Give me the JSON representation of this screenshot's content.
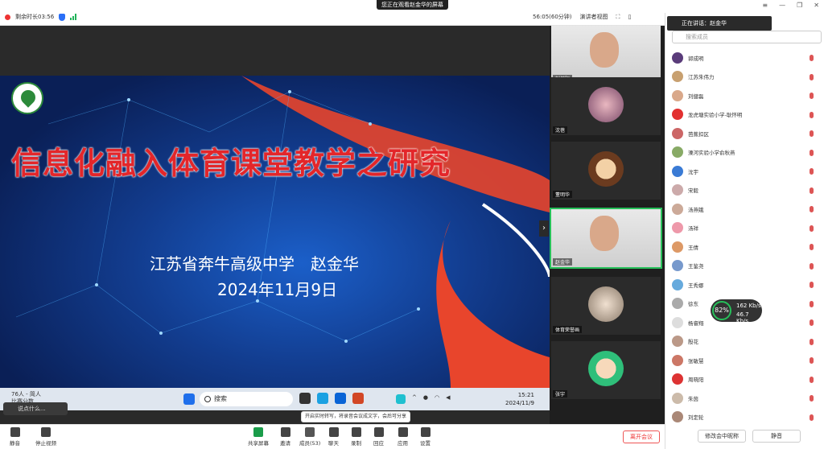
{
  "banner": "您正在观看赵金华的屏幕",
  "topbar": {
    "remaining": "剩余时长03:56",
    "duration": "56:05(60分钟)",
    "view_mode": "演讲者视图"
  },
  "slide": {
    "title": "信息化融入体育课堂教学之研究",
    "subtitle": "江苏省奔牛高级中学　赵金华",
    "date": "2024年11月9日"
  },
  "taskbar": {
    "search": "搜索",
    "people_count": "76人 - 简人",
    "people_sub": "比赛分数",
    "time": "15:21",
    "date": "2024/11/9"
  },
  "chat_hint": "说点什么...",
  "videos": [
    {
      "name": "刘健阳"
    },
    {
      "name": "沈蓓"
    },
    {
      "name": "董明华"
    },
    {
      "name": "赵金华"
    },
    {
      "name": "体育荣誉画"
    },
    {
      "name": "张宇"
    }
  ],
  "panel": {
    "speaking": "正在讲话：赵金华",
    "search_placeholder": "搜索成员",
    "members": [
      {
        "name": "郭成明",
        "color": "#5a3c7a"
      },
      {
        "name": "江苏朱伟力",
        "color": "#c8a070"
      },
      {
        "name": "刘健磊",
        "color": "#d9a88a"
      },
      {
        "name": "龙虎塘实验小学-耿怀明",
        "color": "#e23030"
      },
      {
        "name": "芭蕉扣区",
        "color": "#c66"
      },
      {
        "name": "溧河实验小学俞秋燕",
        "color": "#8a6"
      },
      {
        "name": "沈宇",
        "color": "#3a7bd5"
      },
      {
        "name": "宋毅",
        "color": "#caa"
      },
      {
        "name": "汤燕娥",
        "color": "#ca9"
      },
      {
        "name": "汤祥",
        "color": "#e9a"
      },
      {
        "name": "王倩",
        "color": "#d96"
      },
      {
        "name": "王鉴尧",
        "color": "#79c"
      },
      {
        "name": "王秀娜",
        "color": "#6ad"
      },
      {
        "name": "徐东",
        "color": "#aaa"
      },
      {
        "name": "杨睿翔",
        "color": "#ddd"
      },
      {
        "name": "殷花",
        "color": "#b98"
      },
      {
        "name": "张敏慧",
        "color": "#c76"
      },
      {
        "name": "周晓阳",
        "color": "#d33"
      },
      {
        "name": "朱茵",
        "color": "#cba"
      },
      {
        "name": "刘定轮",
        "color": "#a87"
      }
    ],
    "btn_rename": "修改会中昵称",
    "btn_mute": "静音"
  },
  "network": {
    "percent": "82%",
    "up": "162 Kb/s",
    "down": "46.7 Kb/s"
  },
  "toolbar": {
    "mute": "静音",
    "stop_video": "停止视频",
    "share": "共享屏幕",
    "invite": "邀请",
    "members": "成员(53)",
    "chat": "聊天",
    "record": "录制",
    "react": "回应",
    "apps": "应用",
    "settings": "设置",
    "leave": "离开会议",
    "tip": "开启实时转写，将录音会议成文字，会后可分享"
  }
}
